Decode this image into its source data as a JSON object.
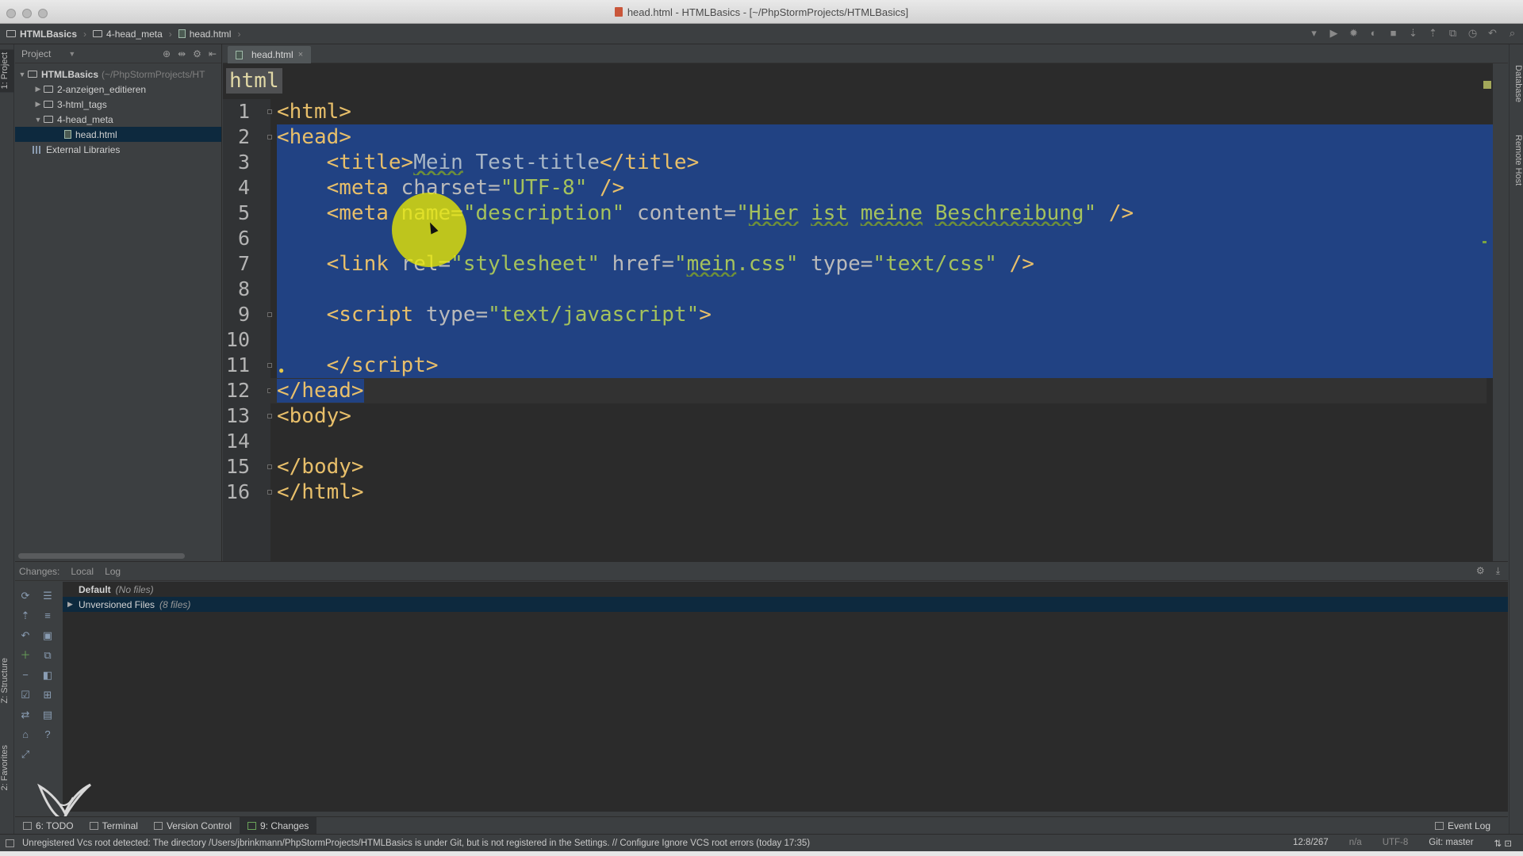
{
  "window": {
    "title": "head.html - HTMLBasics - [~/PhpStormProjects/HTMLBasics]"
  },
  "breadcrumbs": [
    "HTMLBasics",
    "4-head_meta",
    "head.html"
  ],
  "left_strip": {
    "project_tab": "1: Project",
    "structure_tab": "Z: Structure",
    "favorites_tab": "2: Favorites"
  },
  "right_strip": {
    "database_tab": "Database",
    "remote_host_tab": "Remote Host"
  },
  "project_panel": {
    "header": "Project",
    "root": {
      "label": "HTMLBasics",
      "path": "(~/PhpStormProjects/HT"
    },
    "items": [
      {
        "label": "2-anzeigen_editieren"
      },
      {
        "label": "3-html_tags"
      },
      {
        "label": "4-head_meta"
      },
      {
        "label": "head.html"
      },
      {
        "label": "External Libraries"
      }
    ]
  },
  "editor": {
    "tab_label": "head.html",
    "language_badge": "html",
    "line_numbers": [
      "1",
      "2",
      "3",
      "4",
      "5",
      "6",
      "7",
      "8",
      "9",
      "10",
      "11",
      "12",
      "13",
      "14",
      "15",
      "16"
    ]
  },
  "changes_panel": {
    "tabs": [
      "Changes:",
      "Local",
      "Log"
    ],
    "default_changelist": "Default",
    "default_note": "(No files)",
    "unversioned": "Unversioned Files",
    "unversioned_note": "(8 files)"
  },
  "tool_windows": {
    "todo": "6: TODO",
    "terminal": "Terminal",
    "version_control": "Version Control",
    "changes": "9: Changes",
    "event_log": "Event Log"
  },
  "status_bar": {
    "message": "Unregistered Vcs root detected: The directory /Users/jbrinkmann/PhpStormProjects/HTMLBasics is under Git, but is not registered in the Settings. // Configure  Ignore VCS root errors (today 17:35)",
    "position": "12:8/267",
    "na": "n/a",
    "encoding": "UTF-8",
    "git_branch": "Git: master"
  },
  "colors": {
    "selection": "#214283",
    "tag": "#e8bf6a",
    "string": "#a5c25c",
    "attribute": "#bababa",
    "highlight": "#ebeb00"
  }
}
